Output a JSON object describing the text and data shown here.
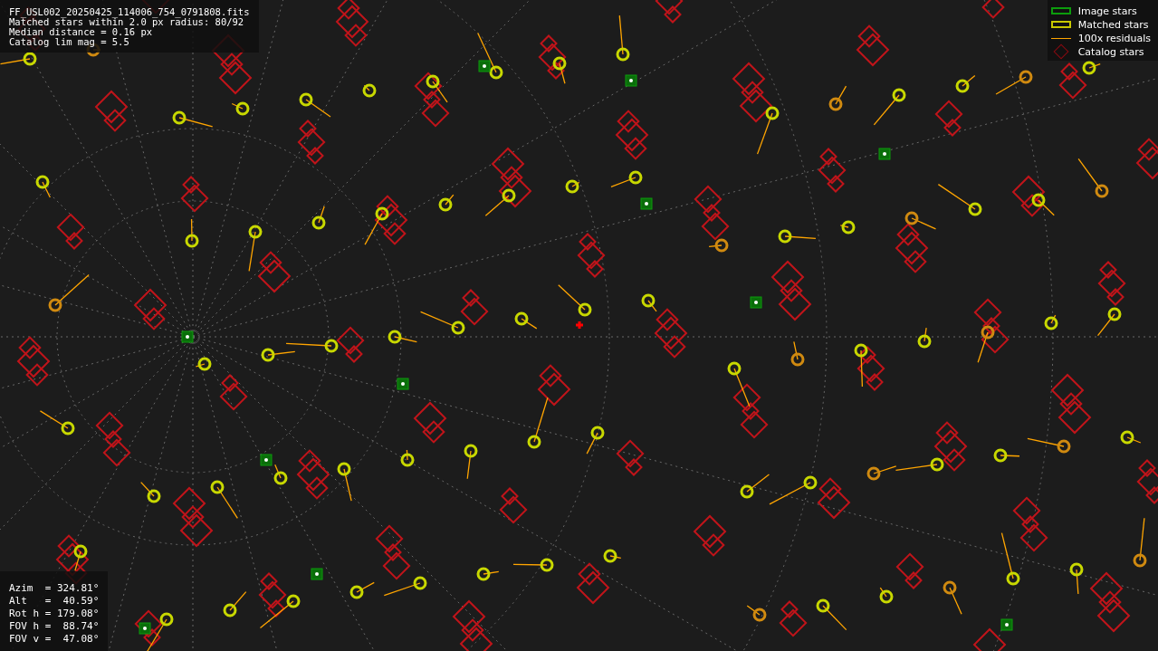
{
  "info": {
    "lines": [
      "FF_USL002_20250425_114006_754_0791808.fits",
      "Matched stars within 2.0 px radius: 80/92",
      "Median distance = 0.16 px",
      "Catalog lim mag = 5.5"
    ]
  },
  "legend": [
    {
      "kind": "image",
      "label": "Image stars"
    },
    {
      "kind": "matched",
      "label": "Matched stars"
    },
    {
      "kind": "residual",
      "label": "100x residuals"
    },
    {
      "kind": "catalog",
      "label": "Catalog stars"
    }
  ],
  "pointing": {
    "lines": [
      "Azim  = 324.81°",
      "Alt   =  40.59°",
      "Rot h = 179.08°",
      "FOV h =  88.74°",
      "FOV v =  47.08°"
    ]
  }
}
